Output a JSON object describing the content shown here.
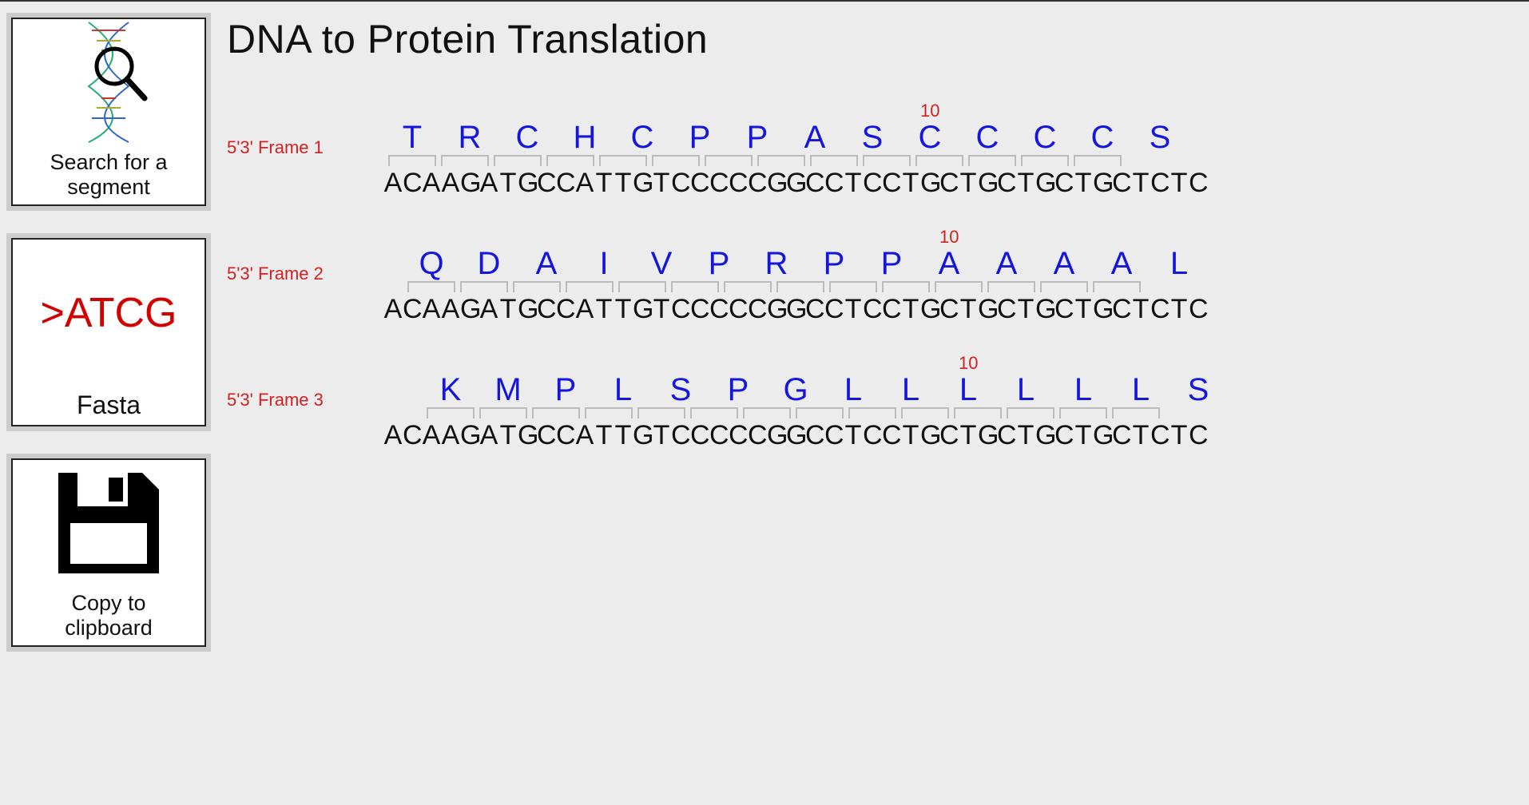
{
  "title": "DNA to Protein Translation",
  "sidebar": {
    "search": {
      "label": "Search for a\nsegment"
    },
    "fasta": {
      "symbol": ">ATCG",
      "label": "Fasta"
    },
    "copy": {
      "label": "Copy to\nclipboard"
    }
  },
  "dna_sequence": "ACAAGATGCCATTGTCCCCCGGCCTCCTGCTGCTGCTGCTCTC",
  "position_marker": {
    "value": "10",
    "at_aa_index": 9
  },
  "frames": [
    {
      "label": "5'3' Frame 1",
      "offset": 0,
      "amino_acids": [
        "T",
        "R",
        "C",
        "H",
        "C",
        "P",
        "P",
        "A",
        "S",
        "C",
        "C",
        "C",
        "C",
        "S"
      ]
    },
    {
      "label": "5'3' Frame 2",
      "offset": 1,
      "amino_acids": [
        "Q",
        "D",
        "A",
        "I",
        "V",
        "P",
        "R",
        "P",
        "P",
        "A",
        "A",
        "A",
        "A",
        "L"
      ]
    },
    {
      "label": "5'3' Frame 3",
      "offset": 2,
      "amino_acids": [
        "K",
        "M",
        "P",
        "L",
        "S",
        "P",
        "G",
        "L",
        "L",
        "L",
        "L",
        "L",
        "L",
        "S"
      ]
    }
  ],
  "colors": {
    "aa": "#1515e0",
    "frame_label": "#d32020",
    "bg": "#ececec"
  }
}
